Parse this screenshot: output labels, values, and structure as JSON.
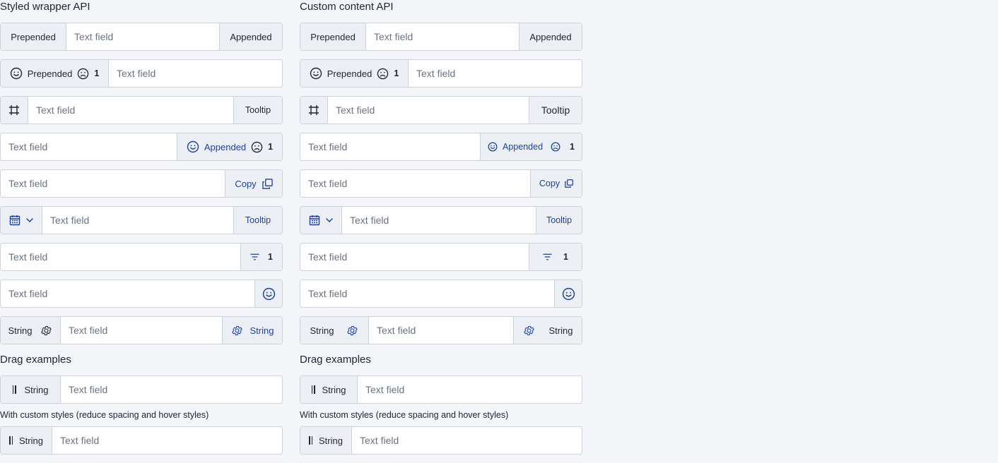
{
  "left": {
    "heading": "Styled wrapper API",
    "rows": {
      "r1": {
        "prepend": "Prepended",
        "placeholder": "Text field",
        "append": "Appended"
      },
      "r2": {
        "prepend": "Prepended",
        "count": "1",
        "placeholder": "Text field"
      },
      "r3": {
        "placeholder": "Text field",
        "append": "Tooltip"
      },
      "r4": {
        "placeholder": "Text field",
        "append": "Appended",
        "count": "1"
      },
      "r5": {
        "placeholder": "Text field",
        "append": "Copy"
      },
      "r6": {
        "placeholder": "Text field",
        "append": "Tooltip"
      },
      "r7": {
        "placeholder": "Text field",
        "count": "1"
      },
      "r8": {
        "placeholder": "Text field"
      },
      "r9": {
        "prepend": "String",
        "placeholder": "Text field",
        "append": "String"
      }
    },
    "drag_heading": "Drag examples",
    "drag_row": {
      "label": "String",
      "placeholder": "Text field"
    },
    "custom_heading": "With custom styles (reduce spacing and hover styles)",
    "custom_row": {
      "label": "String",
      "placeholder": "Text field"
    }
  },
  "right": {
    "heading": "Custom content API",
    "rows": {
      "r1": {
        "prepend": "Prepended",
        "placeholder": "Text field",
        "append": "Appended"
      },
      "r2": {
        "prepend": "Prepended",
        "count": "1",
        "placeholder": "Text field"
      },
      "r3": {
        "placeholder": "Text field",
        "append": "Tooltip"
      },
      "r4": {
        "placeholder": "Text field",
        "append": "Appended",
        "count": "1"
      },
      "r5": {
        "placeholder": "Text field",
        "append": "Copy"
      },
      "r6": {
        "placeholder": "Text field",
        "append": "Tooltip"
      },
      "r7": {
        "placeholder": "Text field",
        "count": "1"
      },
      "r8": {
        "placeholder": "Text field"
      },
      "r9": {
        "prepend": "String",
        "placeholder": "Text field",
        "append": "String"
      }
    },
    "drag_heading": "Drag examples",
    "drag_row": {
      "label": "String",
      "placeholder": "Text field"
    },
    "custom_heading": "With custom styles (reduce spacing and hover styles)",
    "custom_row": {
      "label": "String",
      "placeholder": "Text field"
    }
  },
  "icons": {
    "smile": "smile-icon",
    "frown": "frown-icon",
    "frame": "frame-icon",
    "copy": "copy-icon",
    "calendar": "calendar-icon",
    "chevron": "chevron-down-icon",
    "filter": "filter-icon",
    "gear": "gear-icon",
    "drag": "drag-handle-icon"
  },
  "colors": {
    "accent": "#1f3f9e",
    "addon_bg": "#eceff4",
    "border": "#cdd2da",
    "page_bg": "#f3f5f9"
  }
}
